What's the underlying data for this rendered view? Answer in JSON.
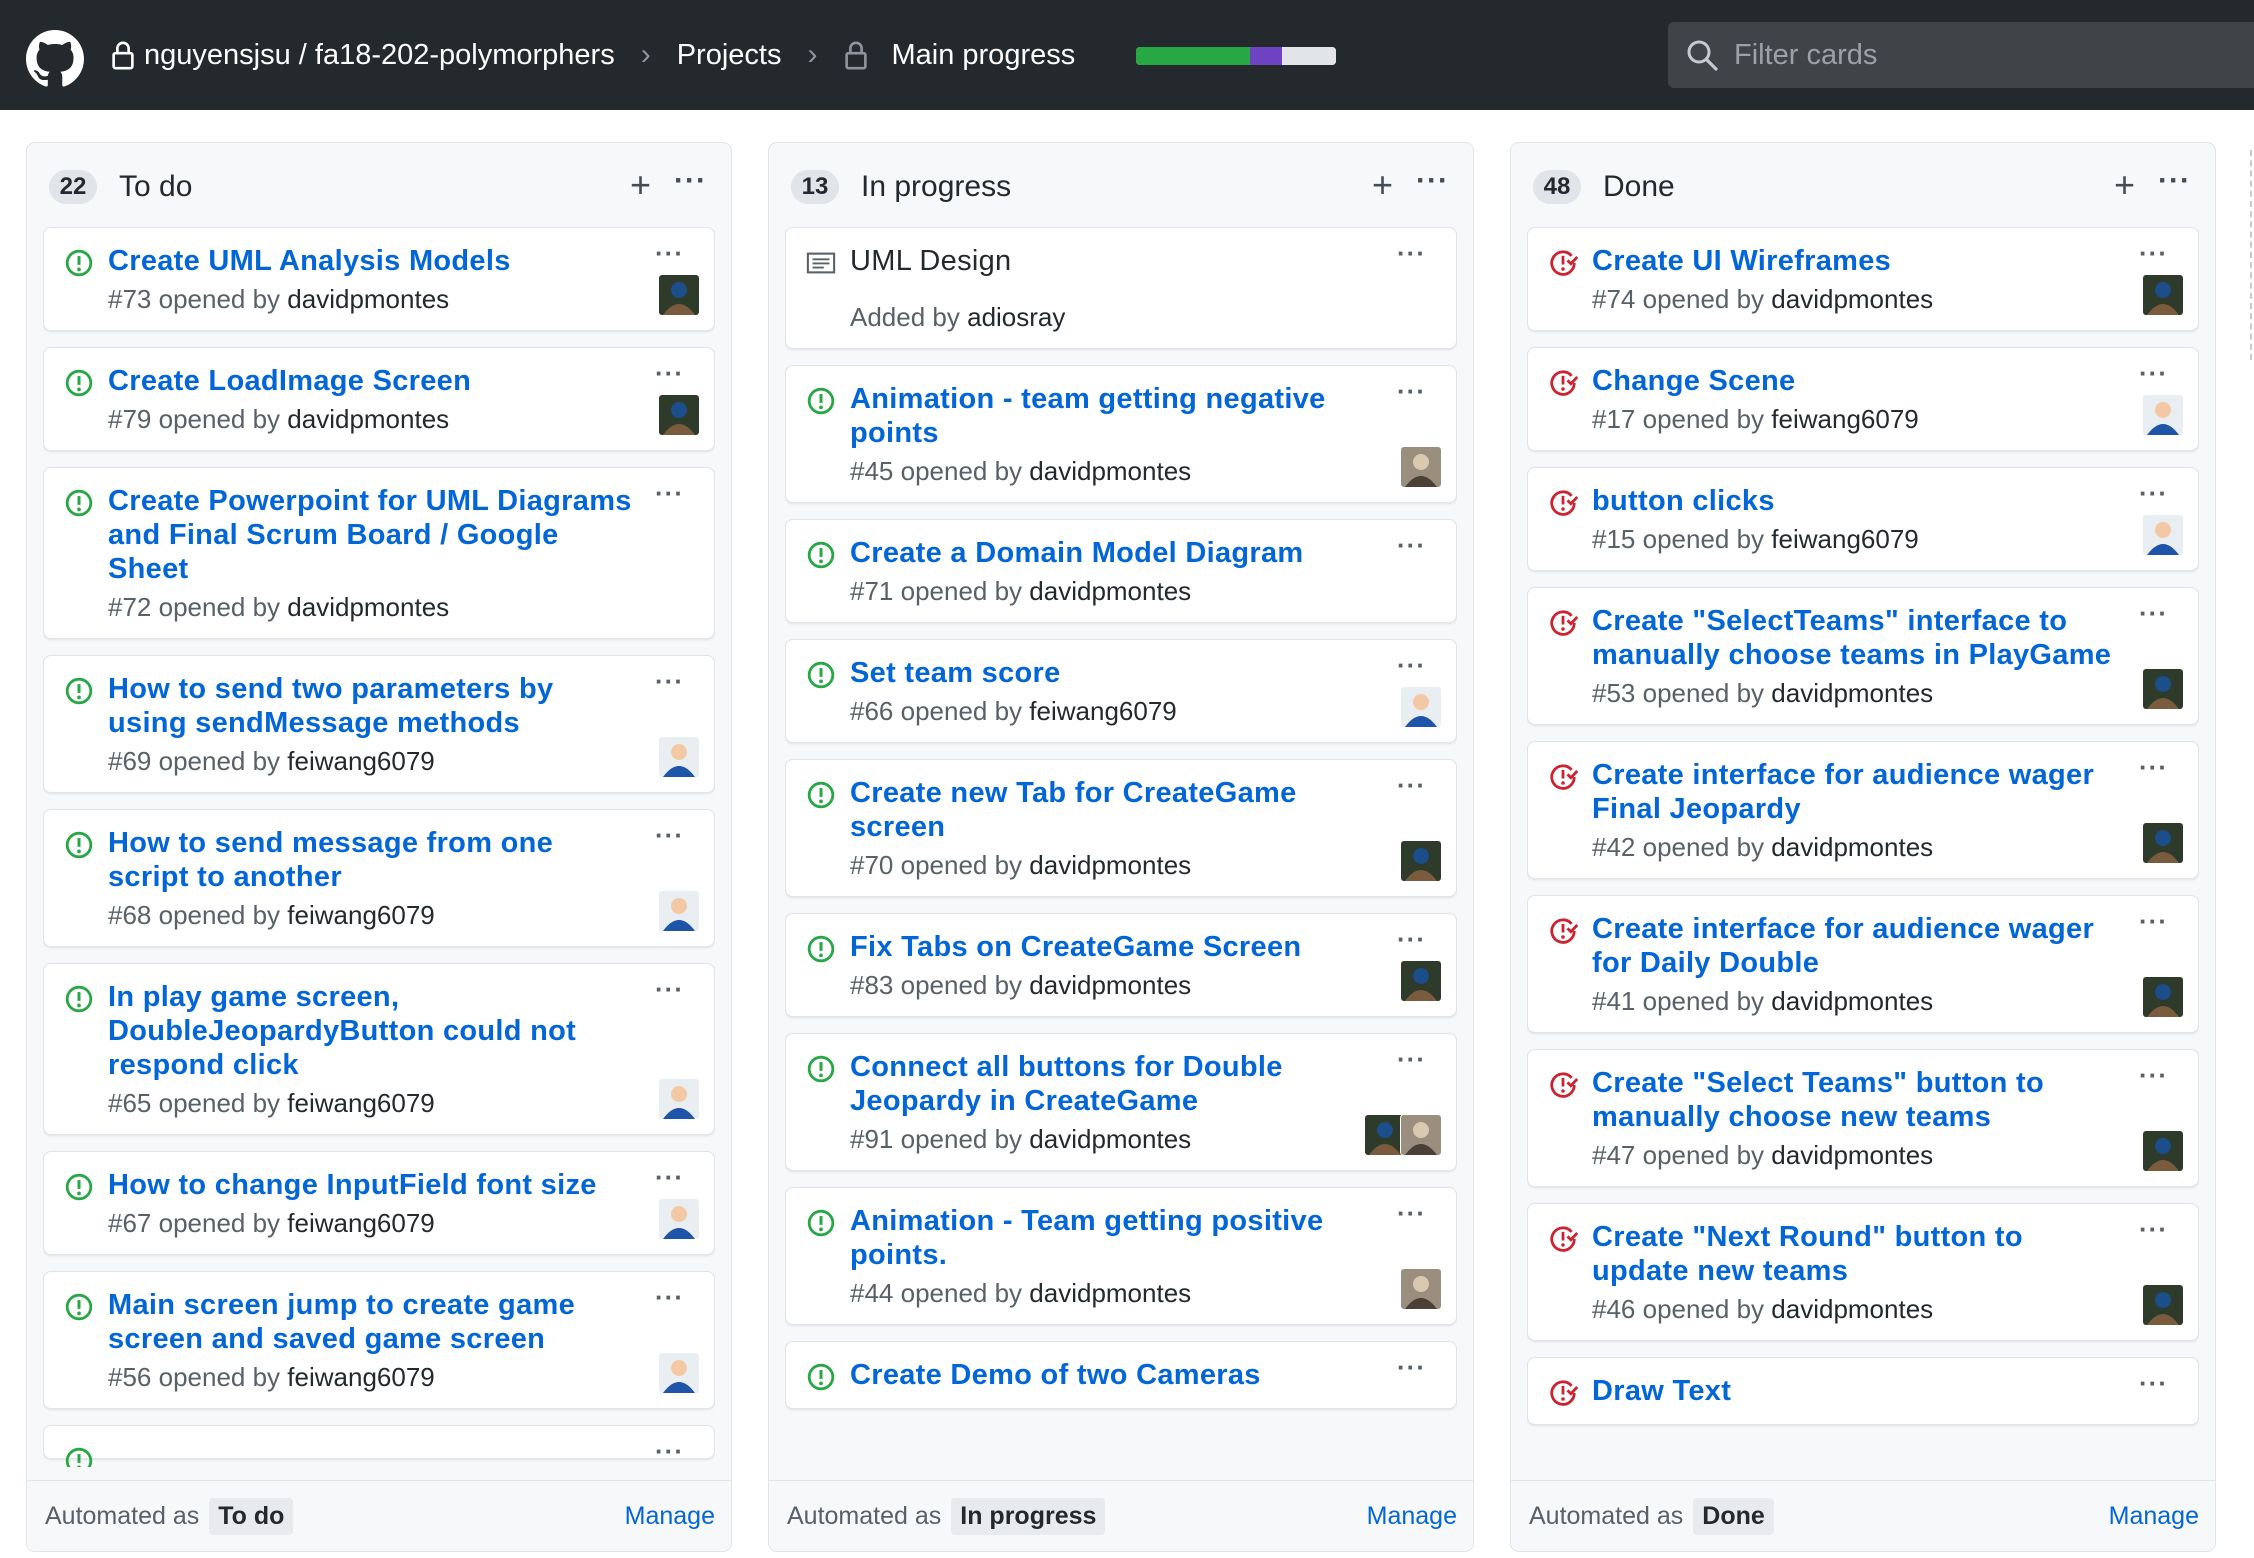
{
  "header": {
    "repo_path": "nguyensjsu / fa18-202-polymorphers",
    "projects": "Projects",
    "project_name": "Main progress",
    "filter_placeholder": "Filter cards",
    "progress": [
      {
        "fraction": 0.57,
        "color": "#28a745"
      },
      {
        "fraction": 0.16,
        "color": "#6f42c1"
      },
      {
        "fraction": 0.27,
        "color": "#e1e4e8"
      }
    ]
  },
  "columns": [
    {
      "count": "22",
      "name": "To do",
      "footer": {
        "label": "Automated as",
        "tag": "To do",
        "manage": "Manage"
      },
      "cards": [
        {
          "kind": "open",
          "title": "Create UML Analysis Models",
          "meta": "#73 opened by",
          "author": "davidpmontes",
          "avatars": [
            "a"
          ]
        },
        {
          "kind": "open",
          "title": "Create LoadImage Screen",
          "meta": "#79 opened by",
          "author": "davidpmontes",
          "avatars": [
            "a"
          ]
        },
        {
          "kind": "open",
          "title": "Create Powerpoint for UML Diagrams and Final Scrum Board / Google Sheet",
          "meta": "#72 opened by",
          "author": "davidpmontes",
          "avatars": []
        },
        {
          "kind": "open",
          "title": "How to send two parameters by using sendMessage methods",
          "meta": "#69 opened by",
          "author": "feiwang6079",
          "avatars": [
            "b"
          ]
        },
        {
          "kind": "open",
          "title": "How to send message from one script to another",
          "meta": "#68 opened by",
          "author": "feiwang6079",
          "avatars": [
            "b"
          ]
        },
        {
          "kind": "open",
          "title": "In play game screen, DoubleJeopardyButton could not respond click",
          "meta": "#65 opened by",
          "author": "feiwang6079",
          "avatars": [
            "b"
          ]
        },
        {
          "kind": "open",
          "title": "How to change InputField font size",
          "meta": "#67 opened by",
          "author": "feiwang6079",
          "avatars": [
            "b"
          ]
        },
        {
          "kind": "open",
          "title": "Main screen jump to create game screen and saved game screen",
          "meta": "#56 opened by",
          "author": "feiwang6079",
          "avatars": [
            "b"
          ]
        },
        {
          "kind": "open",
          "title": "",
          "meta": "",
          "author": "",
          "avatars": []
        }
      ]
    },
    {
      "count": "13",
      "name": "In progress",
      "footer": {
        "label": "Automated as",
        "tag": "In progress",
        "manage": "Manage"
      },
      "cards": [
        {
          "kind": "note",
          "title": "UML Design",
          "meta": "Added by",
          "author": "adiosray",
          "avatars": []
        },
        {
          "kind": "open",
          "title": "Animation - team getting negative points",
          "meta": "#45 opened by",
          "author": "davidpmontes",
          "avatars": [
            "c"
          ]
        },
        {
          "kind": "open",
          "title": "Create a Domain Model Diagram",
          "meta": "#71 opened by",
          "author": "davidpmontes",
          "avatars": []
        },
        {
          "kind": "open",
          "title": "Set team score",
          "meta": "#66 opened by",
          "author": "feiwang6079",
          "avatars": [
            "b"
          ]
        },
        {
          "kind": "open",
          "title": "Create new Tab for CreateGame screen",
          "meta": "#70 opened by",
          "author": "davidpmontes",
          "avatars": [
            "a"
          ]
        },
        {
          "kind": "open",
          "title": "Fix Tabs on CreateGame Screen",
          "meta": "#83 opened by",
          "author": "davidpmontes",
          "avatars": [
            "a"
          ]
        },
        {
          "kind": "open",
          "title": "Connect all buttons for Double Jeopardy in CreateGame",
          "meta": "#91 opened by",
          "author": "davidpmontes",
          "avatars": [
            "a",
            "c"
          ]
        },
        {
          "kind": "open",
          "title": "Animation - Team getting positive points.",
          "meta": "#44 opened by",
          "author": "davidpmontes",
          "avatars": [
            "c"
          ]
        },
        {
          "kind": "open",
          "title": "Create Demo of two Cameras",
          "meta": "",
          "author": "",
          "avatars": []
        }
      ]
    },
    {
      "count": "48",
      "name": "Done",
      "footer": {
        "label": "Automated as",
        "tag": "Done",
        "manage": "Manage"
      },
      "cards": [
        {
          "kind": "closed",
          "title": "Create UI Wireframes",
          "meta": "#74 opened by",
          "author": "davidpmontes",
          "avatars": [
            "a"
          ]
        },
        {
          "kind": "closed",
          "title": "Change Scene",
          "meta": "#17 opened by",
          "author": "feiwang6079",
          "avatars": [
            "b"
          ]
        },
        {
          "kind": "closed",
          "title": "button clicks",
          "meta": "#15 opened by",
          "author": "feiwang6079",
          "avatars": [
            "b"
          ]
        },
        {
          "kind": "closed",
          "title": "Create \"SelectTeams\" interface to manually choose teams in PlayGame",
          "meta": "#53 opened by",
          "author": "davidpmontes",
          "avatars": [
            "a"
          ]
        },
        {
          "kind": "closed",
          "title": "Create interface for audience wager Final Jeopardy",
          "meta": "#42 opened by",
          "author": "davidpmontes",
          "avatars": [
            "a"
          ]
        },
        {
          "kind": "closed",
          "title": "Create interface for audience wager for Daily Double",
          "meta": "#41 opened by",
          "author": "davidpmontes",
          "avatars": [
            "a"
          ]
        },
        {
          "kind": "closed",
          "title": "Create \"Select Teams\" button to manually choose new teams",
          "meta": "#47 opened by",
          "author": "davidpmontes",
          "avatars": [
            "a"
          ]
        },
        {
          "kind": "closed",
          "title": "Create \"Next Round\" button to update new teams",
          "meta": "#46 opened by",
          "author": "davidpmontes",
          "avatars": [
            "a"
          ]
        },
        {
          "kind": "closed",
          "title": "Draw Text",
          "meta": "",
          "author": "",
          "avatars": []
        }
      ]
    }
  ],
  "icons": {
    "logo": "github-icon",
    "lock": "lock-icon",
    "search": "search-icon",
    "open": "issue-opened-icon",
    "closed": "issue-closed-icon",
    "note": "note-icon"
  },
  "colors": {
    "header_bg": "#24292e",
    "link": "#0366d6",
    "open": "#28a745",
    "closed": "#cb2431"
  }
}
